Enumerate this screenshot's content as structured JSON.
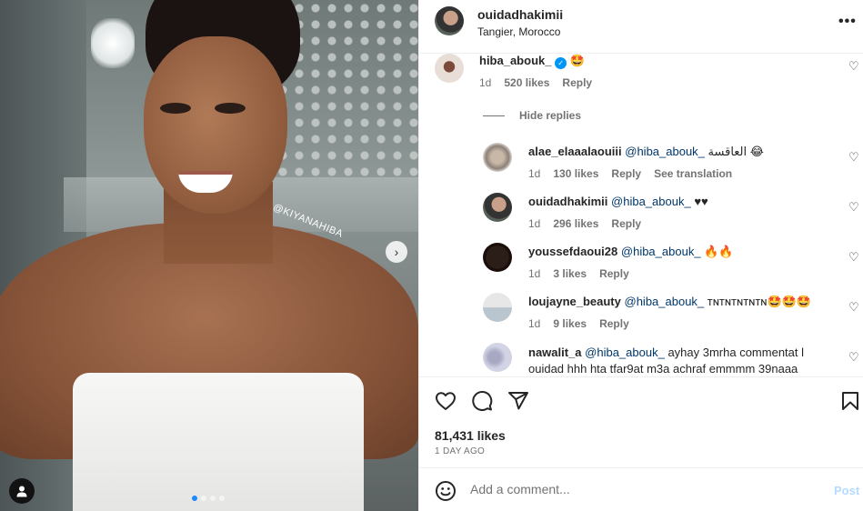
{
  "photo": {
    "watermark": "@KIYANAHIBA",
    "carousel_dots": 4,
    "active_dot": 0
  },
  "post": {
    "username": "ouidadhakimii",
    "location": "Tangier, Morocco",
    "likes": "81,431 likes",
    "time_ago": "1 DAY AGO"
  },
  "comments": [
    {
      "user": "hiba_abouk_",
      "verified": true,
      "text": "🤩",
      "age": "1d",
      "likes": "520 likes",
      "reply": "Reply"
    }
  ],
  "hide_replies": "Hide replies",
  "replies": [
    {
      "user": "alae_elaaalaouiii",
      "mention": "@hiba_abouk_",
      "text": "العاقسة 😂",
      "age": "1d",
      "likes": "130 likes",
      "reply": "Reply",
      "translate": "See translation"
    },
    {
      "user": "ouidadhakimii",
      "mention": "@hiba_abouk_",
      "text": "♥♥",
      "age": "1d",
      "likes": "296 likes",
      "reply": "Reply"
    },
    {
      "user": "youssefdaoui28",
      "mention": "@hiba_abouk_",
      "text": "🔥🔥",
      "age": "1d",
      "likes": "3 likes",
      "reply": "Reply"
    },
    {
      "user": "loujayne_beauty",
      "mention": "@hiba_abouk_",
      "text": "ᴛɴᴛɴᴛɴᴛɴᴛɴ🤩🤩🤩",
      "age": "1d",
      "likes": "9 likes",
      "reply": "Reply"
    },
    {
      "user": "nawalit_a",
      "mention": "@hiba_abouk_",
      "text": "ayhay 3mrha commentat l",
      "text2": "ouidad hhh hta tfar9at m3a achraf emmmm 39naaa"
    }
  ],
  "compose": {
    "placeholder": "Add a comment...",
    "post_label": "Post"
  },
  "icons": {
    "like": "heart-icon",
    "comment": "comment-icon",
    "share": "send-icon",
    "save": "bookmark-icon",
    "emoji": "emoji-icon",
    "more": "more-icon"
  }
}
